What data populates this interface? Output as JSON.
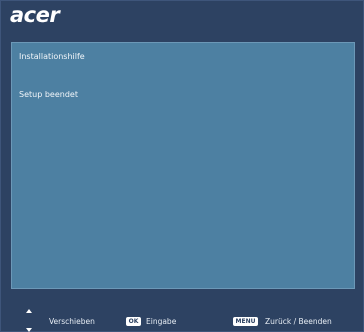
{
  "brand": {
    "logo_text": "acer",
    "colors": {
      "background": "#2d4262",
      "panel": "#4d80a2",
      "text": "#ffffff"
    }
  },
  "menu": {
    "items": [
      {
        "label": "Installationshilfe"
      },
      {
        "label": "Setup beendet"
      }
    ]
  },
  "statusbar": {
    "nav_icon": "up-down-arrows-icon",
    "move_label": "Verschieben",
    "ok_key": "OK",
    "enter_label": "Eingabe",
    "menu_key": "MENU",
    "back_label": "Zurück / Beenden"
  }
}
